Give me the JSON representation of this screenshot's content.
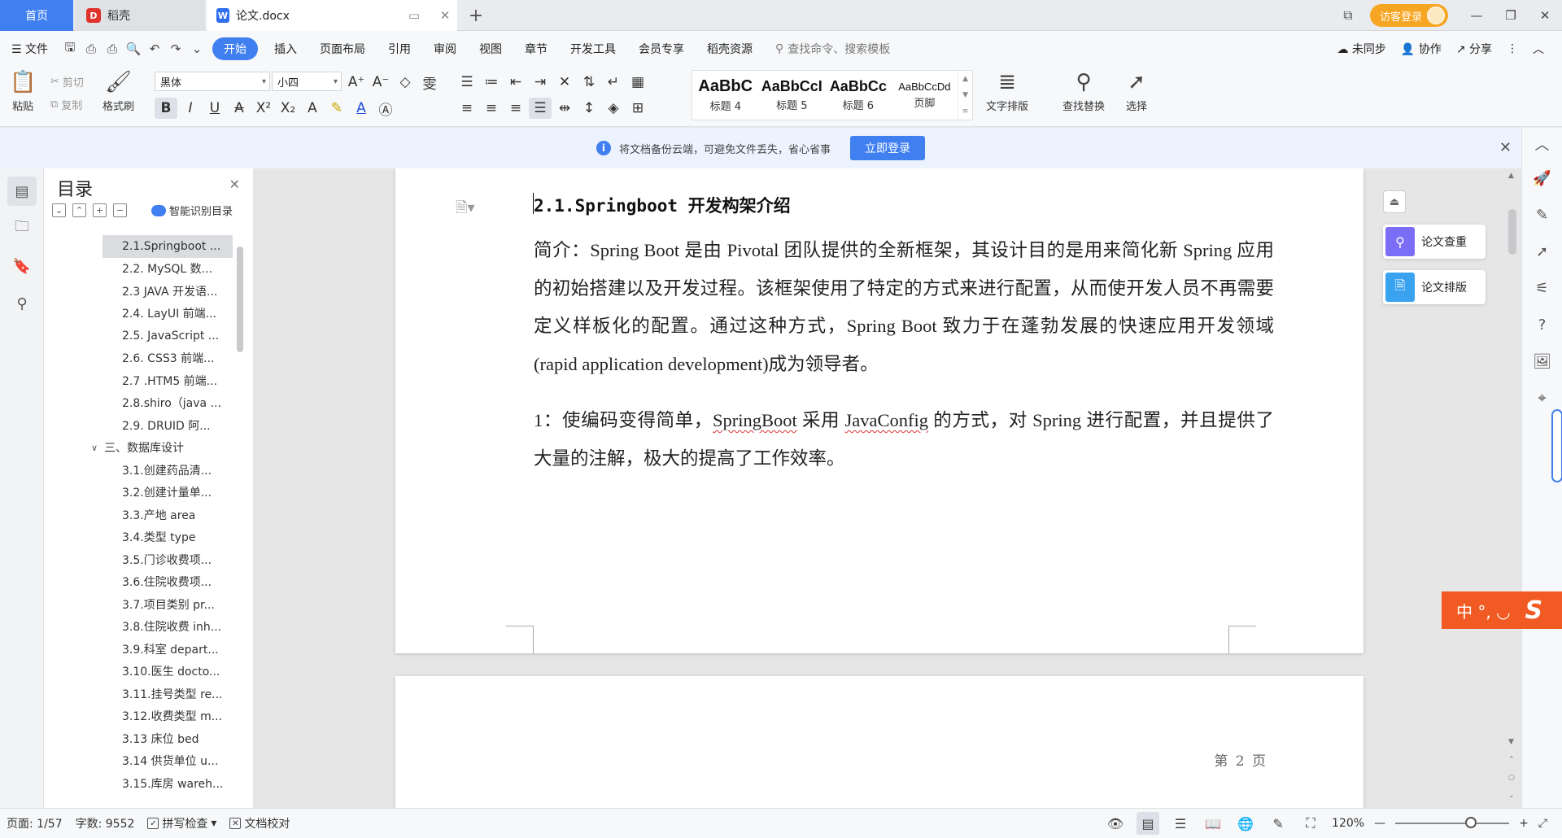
{
  "titlebar": {
    "tabs": [
      {
        "label": "首页"
      },
      {
        "label": "稻壳"
      },
      {
        "label": "论文.docx"
      }
    ],
    "login_label": "访客登录"
  },
  "menubar": {
    "file_label": "文件",
    "items": [
      "开始",
      "插入",
      "页面布局",
      "引用",
      "审阅",
      "视图",
      "章节",
      "开发工具",
      "会员专享",
      "稻壳资源"
    ],
    "search_placeholder": "查找命令、搜索模板",
    "sync_label": "未同步",
    "collab_label": "协作",
    "share_label": "分享"
  },
  "ribbon": {
    "paste_label": "粘贴",
    "cut_label": "剪切",
    "copy_label": "复制",
    "format_painter_label": "格式刷",
    "font_name": "黑体",
    "font_size": "小四",
    "styles": [
      {
        "preview": "AaBbC",
        "label": "标题 4"
      },
      {
        "preview": "AaBbCcI",
        "label": "标题 5"
      },
      {
        "preview": "AaBbCc",
        "label": "标题 6"
      },
      {
        "preview": "AaBbCcDd",
        "label": "页脚"
      }
    ],
    "text_layout_label": "文字排版",
    "find_replace_label": "查找替换",
    "select_label": "选择"
  },
  "notice": {
    "text": "将文档备份云端，可避免文件丢失，省心省事",
    "button_label": "立即登录"
  },
  "toc": {
    "title": "目录",
    "smart_label": "智能识别目录",
    "items": [
      {
        "label": "2.1.Springboot ...",
        "level": 2,
        "selected": true
      },
      {
        "label": "2.2. MySQL 数...",
        "level": 2
      },
      {
        "label": "2.3 JAVA 开发语...",
        "level": 2
      },
      {
        "label": "2.4. LayUI 前端...",
        "level": 2
      },
      {
        "label": "2.5. JavaScript ...",
        "level": 2
      },
      {
        "label": "2.6. CSS3 前端...",
        "level": 2
      },
      {
        "label": "2.7 .HTM5 前端...",
        "level": 2
      },
      {
        "label": "2.8.shiro（java ...",
        "level": 2
      },
      {
        "label": "2.9. DRUID 阿...",
        "level": 2
      },
      {
        "label": "三、数据库设计",
        "level": 1
      },
      {
        "label": "3.1.创建药品清...",
        "level": 2
      },
      {
        "label": "3.2.创建计量单...",
        "level": 2
      },
      {
        "label": "3.3.产地 area",
        "level": 2
      },
      {
        "label": "3.4.类型 type",
        "level": 2
      },
      {
        "label": "3.5.门诊收费项...",
        "level": 2
      },
      {
        "label": "3.6.住院收费项...",
        "level": 2
      },
      {
        "label": "3.7.项目类别 pr...",
        "level": 2
      },
      {
        "label": "3.8.住院收费 inh...",
        "level": 2
      },
      {
        "label": "3.9.科室 depart...",
        "level": 2
      },
      {
        "label": "3.10.医生 docto...",
        "level": 2
      },
      {
        "label": "3.11.挂号类型 re...",
        "level": 2
      },
      {
        "label": "3.12.收费类型 m...",
        "level": 2
      },
      {
        "label": "3.13 床位 bed",
        "level": 2
      },
      {
        "label": "3.14 供货单位 u...",
        "level": 2
      },
      {
        "label": "3.15.库房 wareh...",
        "level": 2
      }
    ]
  },
  "document": {
    "heading": "2.1.Springboot 开发构架介绍",
    "para1": "简介：Spring Boot 是由 Pivotal 团队提供的全新框架，其设计目的是用来简化新 Spring 应用的初始搭建以及开发过程。该框架使用了特定的方式来进行配置，从而使开发人员不再需要定义样板化的配置。通过这种方式，Spring Boot 致力于在蓬勃发展的快速应用开发领域(rapid application development)成为领导者。",
    "para2_a": "1：使编码变得简单，",
    "para2_b": "SpringBoot",
    "para2_c": " 采用 ",
    "para2_d": "JavaConfig",
    "para2_e": " 的方式，对 Spring 进行配置，并且提供了大量的注解，极大的提高了工作效率。",
    "page_number": "第 2 页"
  },
  "float_tools": {
    "check_label": "论文查重",
    "layout_label": "论文排版"
  },
  "ime": {
    "text": "中 °, ◡"
  },
  "statusbar": {
    "page": "页面: 1/57",
    "words": "字数: 9552",
    "spell_check": "拼写检查",
    "proofread": "文档校对",
    "zoom": "120%"
  }
}
